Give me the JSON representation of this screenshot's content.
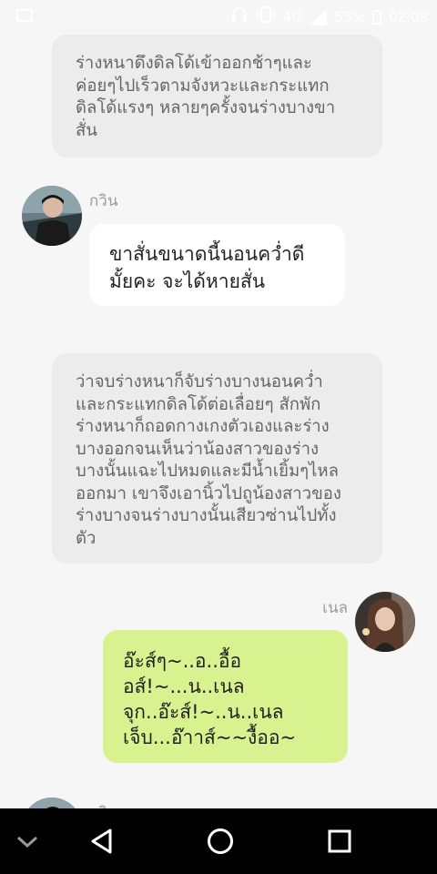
{
  "status_bar": {
    "network": "4G",
    "battery": "55%",
    "time": "02:08",
    "icons": [
      "image-icon",
      "headphones-icon",
      "vibrate-icon",
      "signal-icon",
      "battery-icon"
    ]
  },
  "messages": [
    {
      "type": "narration",
      "text": "ร่างหนาดึงดิลโด้เข้าออกช้าๆและ\nค่อยๆไปเร็วตามจังหวะและกระแทก\nดิลโด้แรงๆ หลายๆครั้งจนร่างบางขา\nสั่น"
    },
    {
      "type": "speech",
      "side": "left",
      "sender": "กวิน",
      "text": "ขาสั่นขนาดนี้นอนคว่ำดี\nมั้ยคะ จะได้หายสั่น"
    },
    {
      "type": "narration",
      "text": "ว่าจบร่างหนาก็จับร่างบางนอนคว่ำ\nและกระแทกดิลโด้ต่อเลื่อยๆ สักพัก\nร่างหนาก็ถอดกางเกงตัวเองและร่าง\nบางออกจนเห็นว่าน้องสาวของร่าง\nบางนั้นแฉะไปหมดและมีน้ำเยิ้มๆไหล\nออกมา เขาจึงเอานิ้วไปถูน้องสาวของ\nร่างบางจนร่างบางนั้นเสียวซ่านไปทั้ง\nตัว"
    },
    {
      "type": "speech",
      "side": "right",
      "sender": "เนล",
      "text": "อ๊ะส์ๆ~..อ..อื้อ\nอส์!~...น..เนล\nจุก..อ๊ะส์!~..น..เนล\nเจ็บ...อ๊าาส์~~งื้ออ~"
    },
    {
      "type": "speech",
      "side": "left",
      "sender": "กวิน",
      "text": ""
    }
  ],
  "nav_bar": {
    "buttons": [
      "collapse-chevron",
      "back",
      "home",
      "recents"
    ]
  },
  "colors": {
    "background": "#f6f6f6",
    "narration_bubble": "#ececec",
    "left_bubble": "#ffffff",
    "right_bubble": "#d7f28f",
    "name_text": "#9a9a9a",
    "nav_bar": "#000000"
  }
}
